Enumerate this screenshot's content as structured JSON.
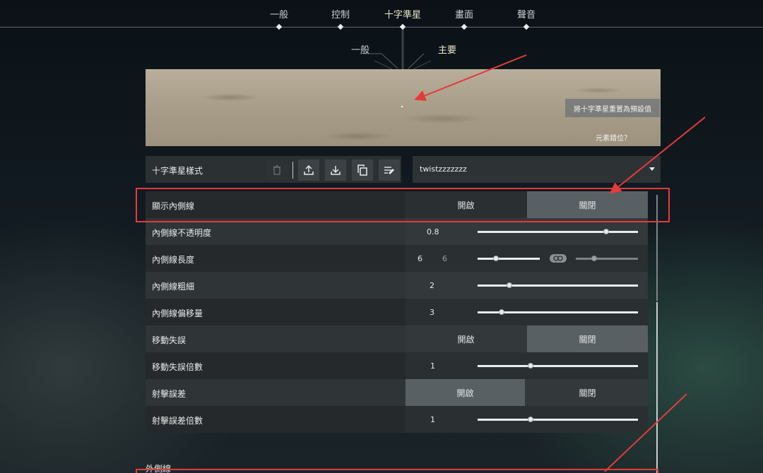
{
  "nav": {
    "tabs": [
      {
        "label": "一般",
        "active": false
      },
      {
        "label": "控制",
        "active": false
      },
      {
        "label": "十字準星",
        "active": true
      },
      {
        "label": "畫面",
        "active": false
      },
      {
        "label": "聲音",
        "active": false
      }
    ]
  },
  "subnav": {
    "tabs": [
      {
        "label": "一般",
        "active": false
      },
      {
        "label": "主要",
        "active": true
      }
    ]
  },
  "preview": {
    "reset_label": "將十字準星重置為預設值",
    "misplace_label": "元素錯位？"
  },
  "crosshair_style": {
    "label": "十字準星樣式",
    "profile": "twistzzzzzzz",
    "toolbar_icons": [
      "trash-icon",
      "upload-icon",
      "download-icon",
      "copy-icon",
      "rename-icon"
    ]
  },
  "settings": [
    {
      "label": "顯示內側線",
      "type": "toggle",
      "on_label": "開啟",
      "off_label": "關閉",
      "selected": "off"
    },
    {
      "label": "內側線不透明度",
      "type": "slider",
      "value": "0.8",
      "fraction": 0.8
    },
    {
      "label": "內側線長度",
      "type": "dual-slider",
      "value": "6",
      "value2": "6",
      "fraction": 0.3,
      "fraction2": 0.3,
      "linked_icon": "link-icon"
    },
    {
      "label": "內側線粗細",
      "type": "slider",
      "value": "2",
      "fraction": 0.2
    },
    {
      "label": "內側線偏移量",
      "type": "slider",
      "value": "3",
      "fraction": 0.15
    },
    {
      "label": "移動失誤",
      "type": "toggle",
      "on_label": "開啟",
      "off_label": "關閉",
      "selected": "off"
    },
    {
      "label": "移動失誤倍數",
      "type": "slider",
      "value": "1",
      "fraction": 0.33
    },
    {
      "label": "射擊誤差",
      "type": "toggle",
      "on_label": "開啟",
      "off_label": "關閉",
      "selected": "on"
    },
    {
      "label": "射擊誤差倍數",
      "type": "slider",
      "value": "1",
      "fraction": 0.33
    }
  ],
  "next_section": {
    "title": "外側線"
  },
  "colors": {
    "highlight_box": "#e53b3b",
    "selected_option": "#596064",
    "accent_text": "#ece8c8"
  }
}
